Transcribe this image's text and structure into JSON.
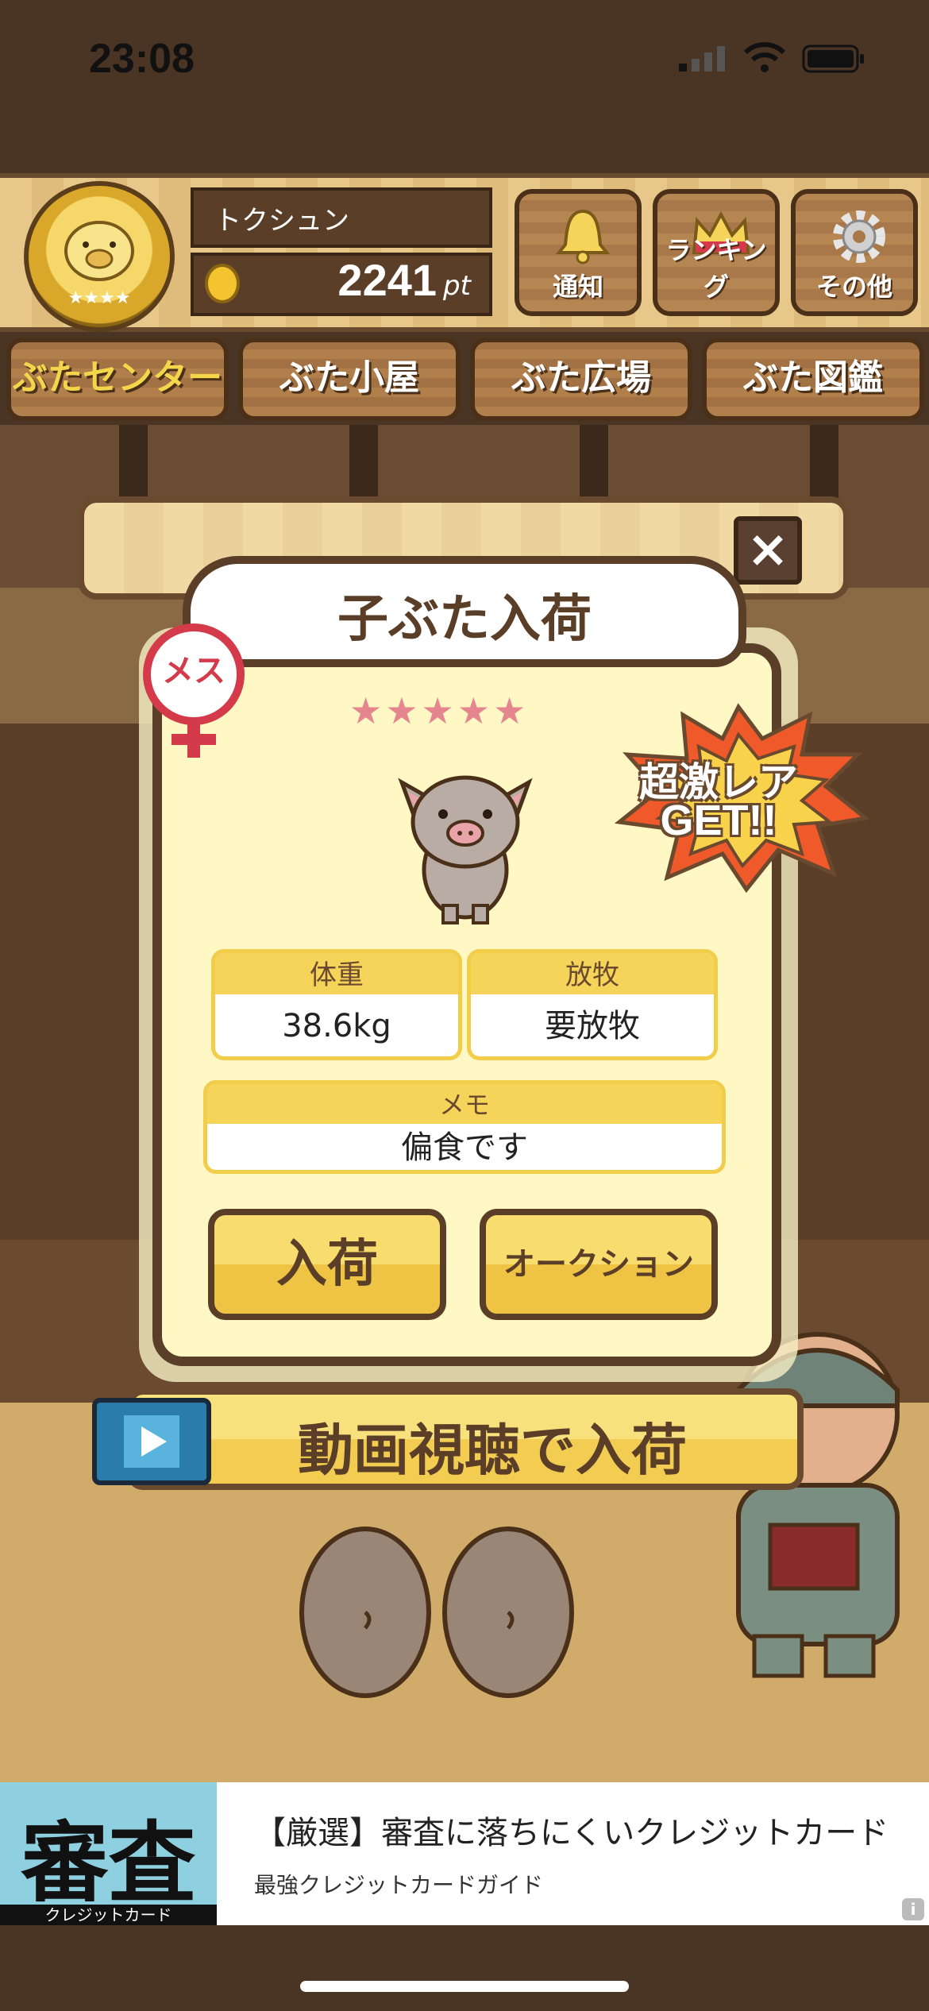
{
  "status_bar": {
    "time": "23:08"
  },
  "header": {
    "player_name": "トクシュン",
    "points": "2241",
    "points_unit": "pt",
    "buttons": [
      {
        "label": "通知",
        "icon": "bell-icon"
      },
      {
        "label": "ランキング",
        "icon": "crown-icon"
      },
      {
        "label": "その他",
        "icon": "gear-icon"
      }
    ]
  },
  "tabs": [
    {
      "label": "ぶたセンター",
      "active": true
    },
    {
      "label": "ぶた小屋",
      "active": false
    },
    {
      "label": "ぶた広場",
      "active": false
    },
    {
      "label": "ぶた図鑑",
      "active": false
    }
  ],
  "backdrop_panel": {
    "close_label": "×"
  },
  "modal": {
    "title": "子ぶた入荷",
    "gender_label": "メス",
    "stars": "★★★★★",
    "rarity_line1": "超激レア",
    "rarity_line2": "GET!!",
    "weight": {
      "label": "体重",
      "value": "38.6kg"
    },
    "grazing": {
      "label": "放牧",
      "value": "要放牧"
    },
    "memo": {
      "label": "メモ",
      "value": "偏食です"
    },
    "stock_button": "入荷",
    "auction_button": "オークション"
  },
  "video_button": {
    "label": "動画視聴で入荷"
  },
  "ad": {
    "image_big_text": "審査",
    "image_small_text": "クレジットカード",
    "title": "【厳選】審査に落ちにくいクレジットカード",
    "subtitle": "最強クレジットカードガイド",
    "info_label": "i"
  },
  "colors": {
    "wood_dark": "#5a3e28",
    "tab_active_text": "#f4d64a",
    "modal_bg": "#fff7c4",
    "accent_yellow": "#f6d45a",
    "female_red": "#d43a4a",
    "star_pink": "#e5868e"
  }
}
